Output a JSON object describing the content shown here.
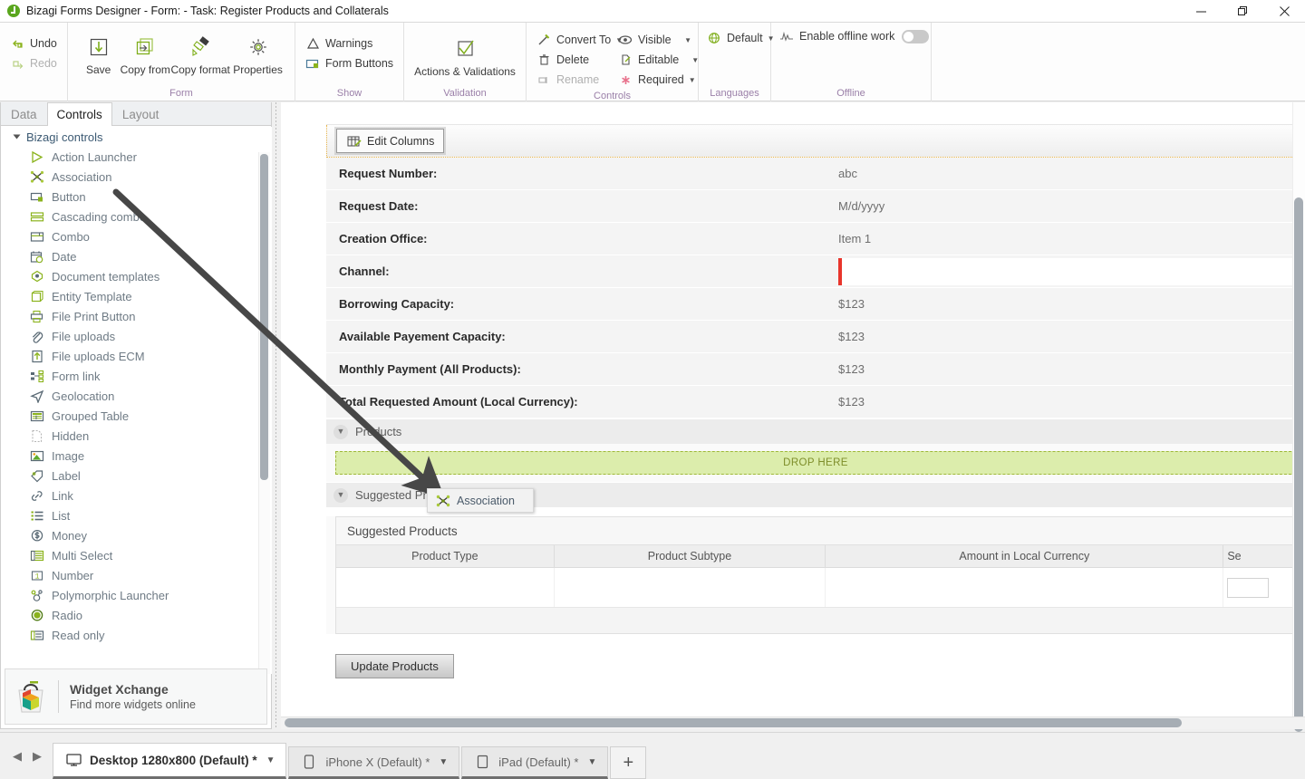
{
  "window": {
    "title": "Bizagi Forms Designer  - Form:  - Task:  Register Products and Collaterals",
    "minimize": "—",
    "maximize": "❐",
    "close": "✕"
  },
  "ribbon": {
    "undo": "Undo",
    "redo": "Redo",
    "groups": [
      {
        "title": "Form",
        "items": [
          "Save",
          "Copy from",
          "Copy format",
          "Properties"
        ]
      },
      {
        "title": "Show",
        "items": [
          "Warnings",
          "Form Buttons"
        ]
      },
      {
        "title": "Validation",
        "items": [
          "Actions & Validations"
        ]
      },
      {
        "title": "Controls",
        "items": [
          "Convert To",
          "Delete",
          "Rename",
          "Visible",
          "Editable",
          "Required"
        ]
      },
      {
        "title": "Languages",
        "items": [
          "Default"
        ]
      },
      {
        "title": "Offline",
        "items": [
          "Enable offline work"
        ]
      }
    ],
    "save_label": "Save",
    "copy_from_label": "Copy from",
    "copy_format_label": "Copy format",
    "properties_label": "Properties",
    "warnings_label": "Warnings",
    "form_buttons_label": "Form Buttons",
    "actions_validations_label": "Actions & Validations",
    "convert_to_label": "Convert To",
    "delete_label": "Delete",
    "rename_label": "Rename",
    "visible_label": "Visible",
    "editable_label": "Editable",
    "required_label": "Required",
    "default_language_label": "Default",
    "enable_offline_label": "Enable offline work",
    "offline_toggle_state": "off",
    "group_titles": {
      "form": "Form",
      "show": "Show",
      "validation": "Validation",
      "controls": "Controls",
      "languages": "Languages",
      "offline": "Offline"
    }
  },
  "left_panel": {
    "tabs": [
      {
        "label": "Data",
        "active": false
      },
      {
        "label": "Controls",
        "active": true
      },
      {
        "label": "Layout",
        "active": false
      }
    ],
    "tree_root": "Bizagi controls",
    "controls": [
      {
        "label": "Action Launcher",
        "icon": "play-triangle-icon"
      },
      {
        "label": "Association",
        "icon": "association-icon"
      },
      {
        "label": "Button",
        "icon": "button-icon"
      },
      {
        "label": "Cascading combo",
        "icon": "cascading-combo-icon"
      },
      {
        "label": "Combo",
        "icon": "combo-icon"
      },
      {
        "label": "Date",
        "icon": "calendar-icon"
      },
      {
        "label": "Document templates",
        "icon": "document-templates-icon"
      },
      {
        "label": "Entity Template",
        "icon": "entity-template-icon"
      },
      {
        "label": "File Print Button",
        "icon": "printer-icon"
      },
      {
        "label": "File uploads",
        "icon": "paperclip-icon"
      },
      {
        "label": "File uploads ECM",
        "icon": "upload-arrow-icon"
      },
      {
        "label": "Form link",
        "icon": "form-link-icon"
      },
      {
        "label": "Geolocation",
        "icon": "geolocation-icon"
      },
      {
        "label": "Grouped Table",
        "icon": "grouped-table-icon"
      },
      {
        "label": "Hidden",
        "icon": "hidden-icon"
      },
      {
        "label": "Image",
        "icon": "image-icon"
      },
      {
        "label": "Label",
        "icon": "label-tag-icon"
      },
      {
        "label": "Link",
        "icon": "link-chain-icon"
      },
      {
        "label": "List",
        "icon": "list-icon"
      },
      {
        "label": "Money",
        "icon": "money-icon"
      },
      {
        "label": "Multi Select",
        "icon": "multi-select-icon"
      },
      {
        "label": "Number",
        "icon": "number-icon"
      },
      {
        "label": "Polymorphic Launcher",
        "icon": "polymorphic-launcher-icon"
      },
      {
        "label": "Radio",
        "icon": "radio-icon"
      },
      {
        "label": "Read only",
        "icon": "read-only-icon"
      }
    ],
    "widget": {
      "title": "Widget Xchange",
      "subtitle": "Find more widgets online"
    }
  },
  "canvas": {
    "edit_columns_label": "Edit Columns",
    "form_rows": [
      {
        "label": "Request Number:",
        "value": "abc",
        "type": "text"
      },
      {
        "label": "Request Date:",
        "value": "M/d/yyyy",
        "type": "text"
      },
      {
        "label": "Creation Office:",
        "value": "Item 1",
        "type": "text"
      },
      {
        "label": "Channel:",
        "value": "",
        "type": "required-input"
      },
      {
        "label": "Borrowing Capacity:",
        "value": "$123",
        "type": "text"
      },
      {
        "label": "Available Payement Capacity:",
        "value": "$123",
        "type": "text"
      },
      {
        "label": "Monthly Payment (All Products):",
        "value": "$123",
        "type": "text"
      },
      {
        "label": "Total Requested Amount (Local Currency):",
        "value": "$123",
        "type": "text"
      }
    ],
    "products_section": {
      "title": "Products",
      "drop_here": "DROP HERE"
    },
    "suggested_section": {
      "title": "Suggested Products",
      "table_caption": "Suggested Products",
      "columns": [
        "Product Type",
        "Product Subtype",
        "Amount in Local Currency",
        "Se"
      ],
      "rows": []
    },
    "update_products_label": "Update Products"
  },
  "drag_ghost": {
    "label": "Association",
    "icon": "association-icon"
  },
  "device_bar": {
    "prev": "◀",
    "next": "▶",
    "tabs": [
      {
        "label": "Desktop 1280x800 (Default) *",
        "icon": "monitor-icon",
        "active": true
      },
      {
        "label": "iPhone X (Default) *",
        "icon": "phone-icon",
        "active": false
      },
      {
        "label": "iPad (Default) *",
        "icon": "tablet-icon",
        "active": false
      }
    ],
    "add_label": "+"
  },
  "colors": {
    "brand_green": "#8bb31d",
    "drop_bg": "#dcedac",
    "drop_border": "#9eb838",
    "required_red": "#e8352c",
    "group_title": "#9a7fa8"
  }
}
